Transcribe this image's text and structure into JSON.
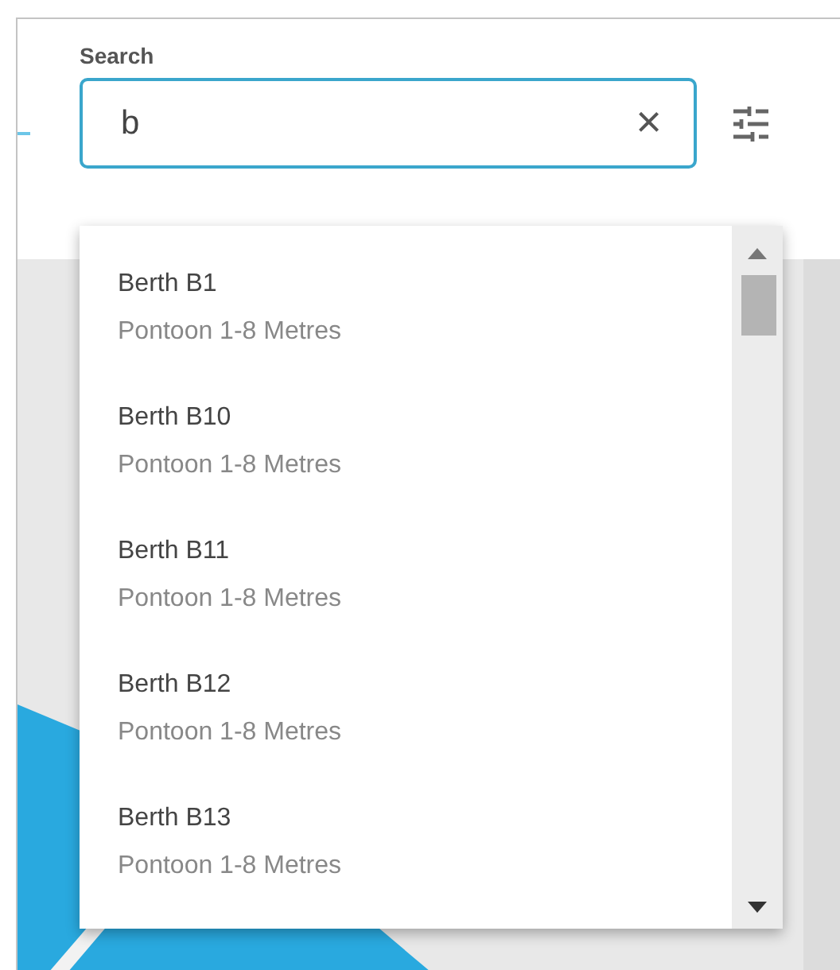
{
  "search": {
    "label": "Search",
    "value": "b",
    "clear_icon": "×"
  },
  "results": [
    {
      "name": "Berth B1",
      "detail": "Pontoon 1-8 Metres"
    },
    {
      "name": "Berth B10",
      "detail": "Pontoon 1-8 Metres"
    },
    {
      "name": "Berth B11",
      "detail": "Pontoon 1-8 Metres"
    },
    {
      "name": "Berth B12",
      "detail": "Pontoon 1-8 Metres"
    },
    {
      "name": "Berth B13",
      "detail": "Pontoon 1-8 Metres"
    }
  ]
}
